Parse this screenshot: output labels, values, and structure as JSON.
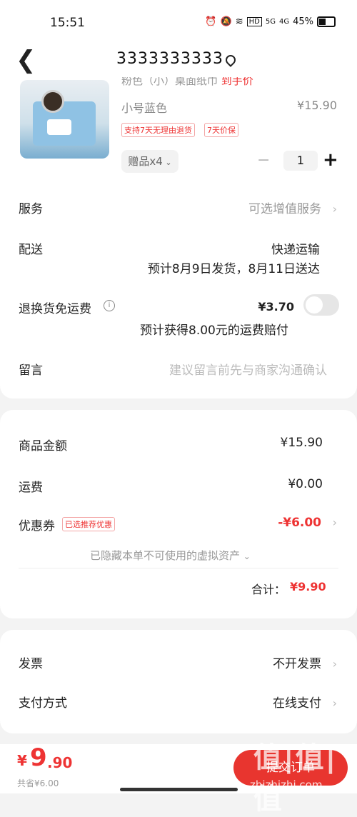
{
  "status_bar": {
    "time": "15:51",
    "signal_5g": "5G",
    "signal_4g": "4G",
    "hd": "HD",
    "battery": "45%"
  },
  "nav": {
    "title": "3333333333"
  },
  "product": {
    "cutoff_text": "粉色（小）桌面纸巾",
    "cutoff_red": "到手价",
    "variant": "小号蓝色",
    "price": "¥15.90",
    "tags": [
      "支持7天无理由退货",
      "7天价保"
    ],
    "gift_label": "赠品x4",
    "quantity": "1",
    "minus": "−",
    "plus": "+"
  },
  "rows": {
    "service": {
      "label": "服务",
      "value": "可选增值服务"
    },
    "delivery": {
      "label": "配送",
      "value": "快递运输",
      "sub": "预计8月9日发货，8月11日送达"
    },
    "return_shipping": {
      "label": "退换货免运费",
      "value": "¥3.70",
      "sub": "预计获得8.00元的运费赔付"
    },
    "message": {
      "label": "留言",
      "placeholder": "建议留言前先与商家沟通确认"
    }
  },
  "summary": {
    "goods_amount": {
      "label": "商品金额",
      "value": "¥15.90"
    },
    "shipping": {
      "label": "运费",
      "value": "¥0.00"
    },
    "coupon": {
      "label": "优惠券",
      "badge": "已选推荐优惠",
      "value": "-¥6.00"
    },
    "hidden_assets": "已隐藏本单不可使用的虚拟资产",
    "total_label": "合计：",
    "total_value": "¥9.90"
  },
  "invoice": {
    "label": "发票",
    "value": "不开发票"
  },
  "payment": {
    "label": "支付方式",
    "value": "在线支付"
  },
  "bottom": {
    "currency": "¥",
    "total_int": "9",
    "total_dec": ".90",
    "saved": "共省¥6.00",
    "submit": "提交订单"
  },
  "watermark": {
    "main": "值|值|值",
    "sub": "zhizhizhi.com"
  },
  "colors": {
    "accent": "#e33333",
    "button": "#e8352f"
  }
}
